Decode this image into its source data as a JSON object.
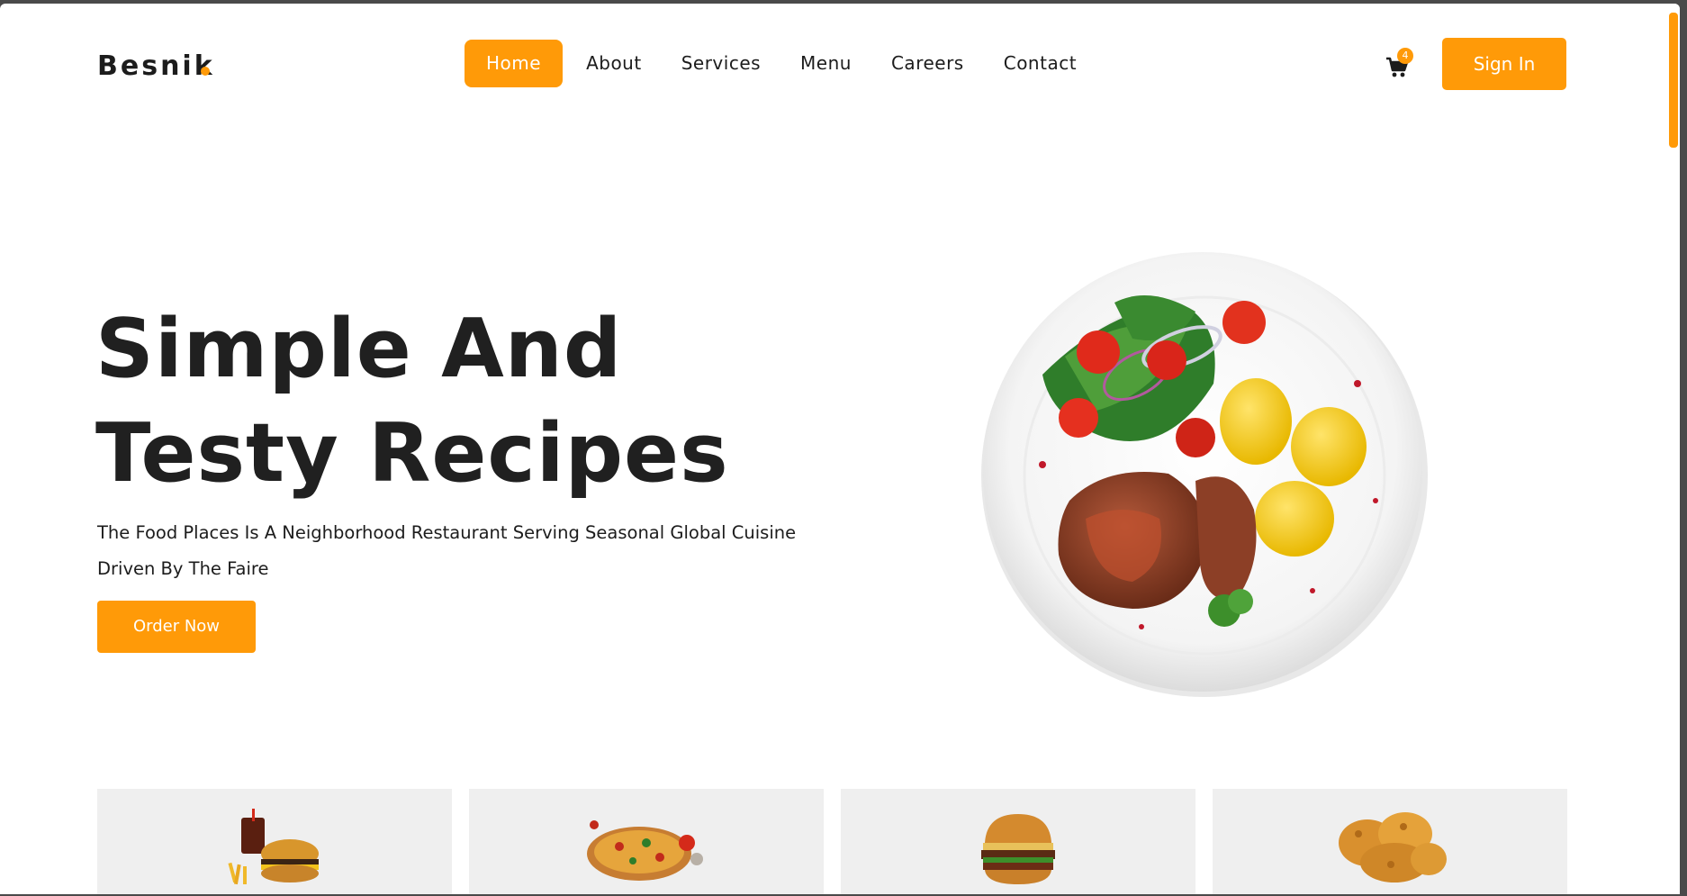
{
  "brand": {
    "name": "Besnik",
    "accent_color": "#ff9a08"
  },
  "nav": {
    "items": [
      {
        "label": "Home",
        "active": true
      },
      {
        "label": "About",
        "active": false
      },
      {
        "label": "Services",
        "active": false
      },
      {
        "label": "Menu",
        "active": false
      },
      {
        "label": "Careers",
        "active": false
      },
      {
        "label": "Contact",
        "active": false
      }
    ]
  },
  "header": {
    "cart_icon": "shopping-cart-icon",
    "cart_count": "4",
    "signin_label": "Sign In"
  },
  "hero": {
    "title_line1": "Simple And",
    "title_line2": "Testy Recipes",
    "subtitle": "The Food Places Is A Neighborhood Restaurant Serving Seasonal Global Cuisine Driven By The Faire",
    "cta_label": "Order Now",
    "image": "food-plate-image"
  },
  "categories": [
    {
      "image": "burger-combo-image"
    },
    {
      "image": "pizza-image"
    },
    {
      "image": "burger-image"
    },
    {
      "image": "fried-chicken-image"
    }
  ]
}
